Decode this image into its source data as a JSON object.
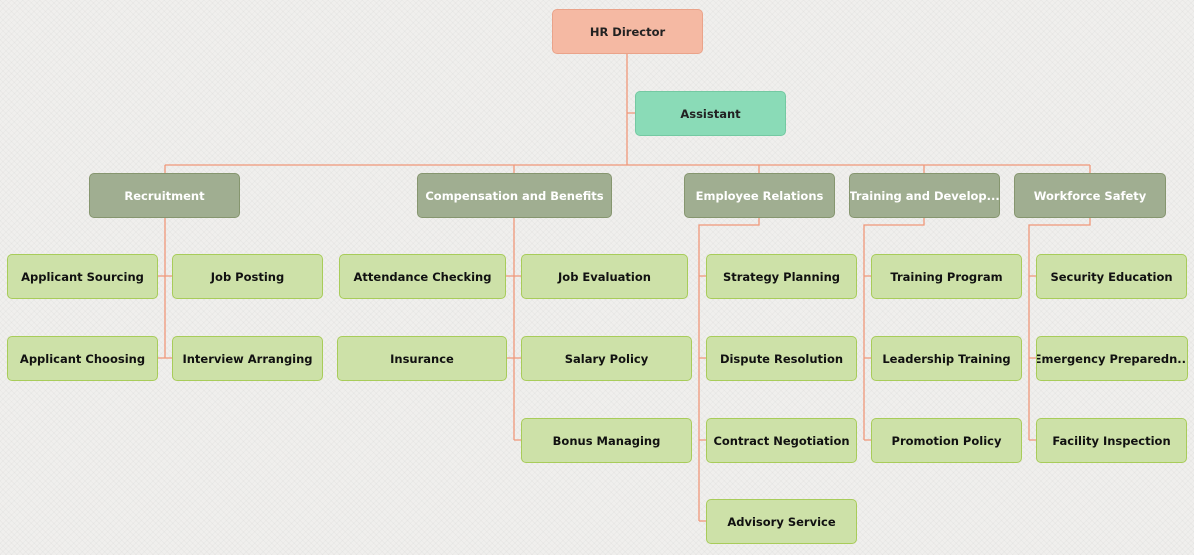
{
  "root": {
    "label": "HR Director"
  },
  "assistant": {
    "label": "Assistant"
  },
  "departments": [
    {
      "label": "Recruitment",
      "children": [
        "Applicant Sourcing",
        "Job Posting",
        "Applicant Choosing",
        "Interview Arranging"
      ]
    },
    {
      "label": "Compensation and Benefits",
      "children": [
        "Attendance Checking",
        "Job Evaluation",
        "Insurance",
        "Salary Policy",
        "Bonus Managing"
      ]
    },
    {
      "label": "Employee Relations",
      "children": [
        "Strategy Planning",
        "Dispute Resolution",
        "Contract Negotiation",
        "Advisory Service"
      ]
    },
    {
      "label": "Training and Develop...",
      "children": [
        "Training Program",
        "Leadership Training",
        "Promotion Policy"
      ]
    },
    {
      "label": "Workforce Safety",
      "children": [
        "Security Education",
        "Emergency Preparedn...",
        "Facility Inspection"
      ]
    }
  ],
  "colors": {
    "connector": "#f0987a",
    "root": "#f5b9a3",
    "assistant": "#8adbb7",
    "department": "#a0ae91",
    "leaf": "#cde1a8"
  }
}
